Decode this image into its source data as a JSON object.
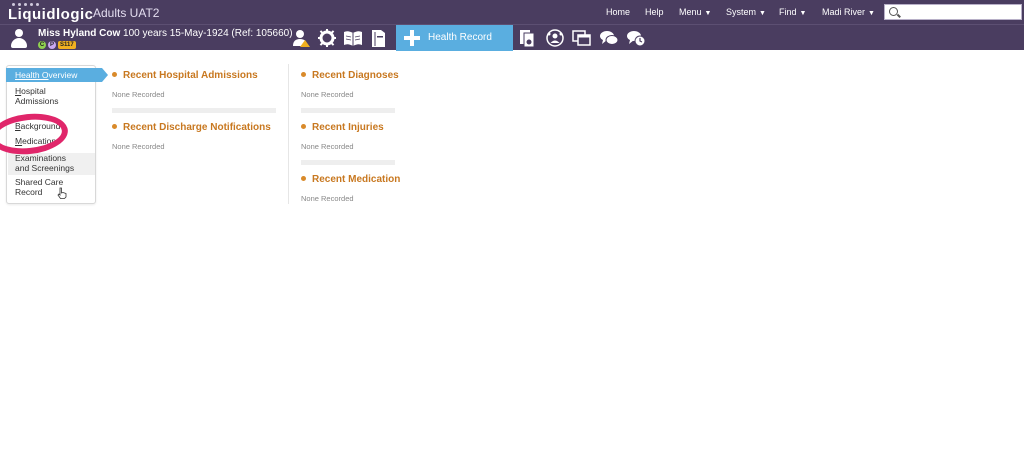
{
  "app": {
    "logo": "Liquidlogic",
    "environment": "Adults UAT2"
  },
  "nav": {
    "home": "Home",
    "help": "Help",
    "menu": "Menu",
    "system": "System",
    "find": "Find",
    "user": "Madi River",
    "caret": "▼"
  },
  "search": {
    "value": "",
    "placeholder": ""
  },
  "patient": {
    "name": "Miss Hyland Cow",
    "details": "100 years 15-May-1924 (Ref: 105660)",
    "badges": {
      "c": "C",
      "p": "P",
      "ref": "S117"
    }
  },
  "toolbar": {
    "health_record_tab": "Health Record"
  },
  "sidemenu": {
    "items": [
      {
        "label_u": "Health O",
        "label_rest": "verview"
      },
      {
        "label_u": "H",
        "label_rest": "ospital",
        "label2": "Admissions"
      },
      {
        "label_u": "B",
        "label_rest": "ackground"
      },
      {
        "label_u": "M",
        "label_rest": "edication"
      },
      {
        "label": "Examinations",
        "label2": "and Screenings"
      },
      {
        "label": "Shared Care",
        "label2": "Record"
      }
    ]
  },
  "panels": {
    "left": [
      {
        "title": "Recent Hospital Admissions",
        "status": "None Recorded"
      },
      {
        "title": "Recent Discharge Notifications",
        "status": "None Recorded"
      }
    ],
    "right": [
      {
        "title": "Recent Diagnoses",
        "status": "None Recorded"
      },
      {
        "title": "Recent Injuries",
        "status": "None Recorded"
      },
      {
        "title": "Recent Medication",
        "status": "None Recorded"
      }
    ]
  },
  "colors": {
    "header_bg": "#4a3d60",
    "active_tab": "#5aaee0",
    "panel_title": "#c87820",
    "annotation_ring": "#e0266a"
  }
}
